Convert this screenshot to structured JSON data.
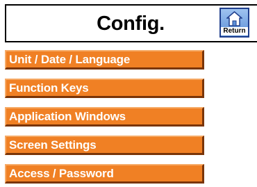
{
  "header": {
    "title": "Config.",
    "return_label": "Return",
    "return_icon": "home-icon"
  },
  "menu": {
    "items": [
      {
        "label": "Unit / Date / Language"
      },
      {
        "label": "Function Keys"
      },
      {
        "label": "Application Windows"
      },
      {
        "label": "Screen Settings"
      },
      {
        "label": "Access / Password"
      }
    ]
  },
  "colors": {
    "menu_fill": "#f08024",
    "menu_highlight": "#f6aa66",
    "menu_shadow": "#7a3508",
    "return_button": "#5b8fd6",
    "background": "#ffffff"
  }
}
